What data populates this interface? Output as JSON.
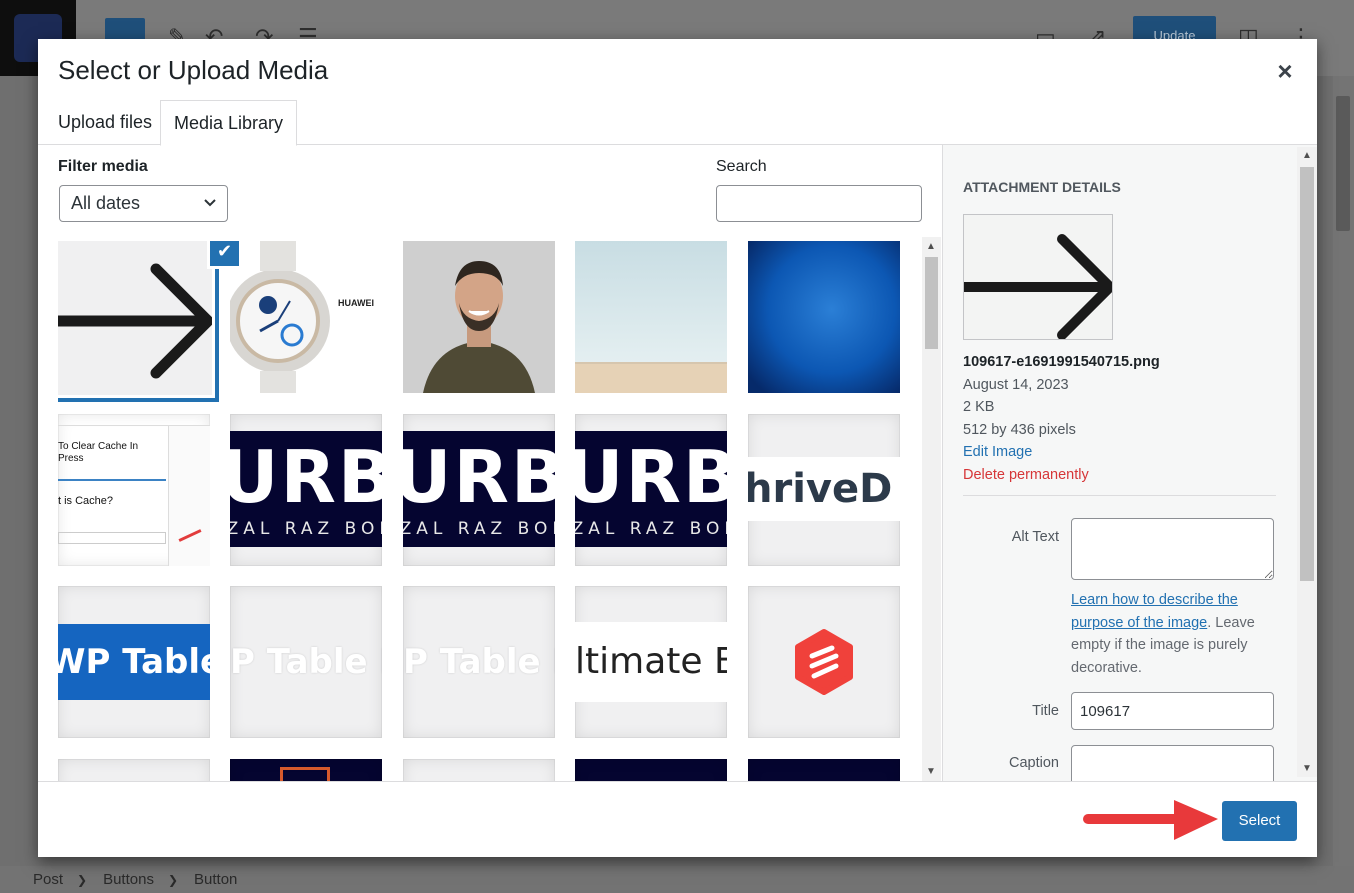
{
  "background": {
    "update_label": "Update",
    "breadcrumb": [
      "Post",
      "Buttons",
      "Button"
    ]
  },
  "modal": {
    "title": "Select or Upload Media",
    "close_label": "×",
    "tabs": [
      {
        "label": "Upload files",
        "active": false
      },
      {
        "label": "Media Library",
        "active": true
      }
    ],
    "filter": {
      "label": "Filter media",
      "selected": "All dates"
    },
    "search": {
      "label": "Search",
      "value": ""
    },
    "grid_items": [
      {
        "name": "arrow-image",
        "selected": true
      },
      {
        "name": "huawei-watch-image",
        "text": "HUAWEI"
      },
      {
        "name": "man-portrait-image"
      },
      {
        "name": "empty-room-image"
      },
      {
        "name": "blue-texture-image"
      },
      {
        "name": "clear-cache-screenshot",
        "heading": "To Clear Cache In",
        "heading2": "Press",
        "question": "t is Cache?"
      },
      {
        "name": "urb-logo-1",
        "text": "URB",
        "subtext": "ZZAL RAZ BON"
      },
      {
        "name": "urb-logo-2",
        "text": "URB",
        "subtext": "ZZAL RAZ BON"
      },
      {
        "name": "urb-logo-3",
        "text": "URB",
        "subtext": "ZZAL RAZ BON"
      },
      {
        "name": "thrive-logo",
        "text": "hriveD"
      },
      {
        "name": "wp-table-blue",
        "text": "WP Table B"
      },
      {
        "name": "wp-table-white-1",
        "text": "P Table B"
      },
      {
        "name": "wp-table-white-2",
        "text": "P Table B"
      },
      {
        "name": "ultimate-blocks",
        "text": "ltimate B"
      },
      {
        "name": "red-logo"
      }
    ],
    "attachment": {
      "heading": "ATTACHMENT DETAILS",
      "filename": "109617-e1691991540715.png",
      "date": "August 14, 2023",
      "size": "2 KB",
      "dimensions": "512 by 436 pixels",
      "edit_label": "Edit Image",
      "delete_label": "Delete permanently",
      "alt_text_label": "Alt Text",
      "alt_text_value": "",
      "help_link": "Learn how to describe the purpose of the image",
      "help_rest": ". Leave empty if the image is purely decorative.",
      "title_label": "Title",
      "title_value": "109617",
      "caption_label": "Caption",
      "caption_value": ""
    },
    "select_label": "Select"
  },
  "colors": {
    "primary": "#2271b1",
    "danger": "#d63638",
    "arrow_red": "#e8393b"
  }
}
